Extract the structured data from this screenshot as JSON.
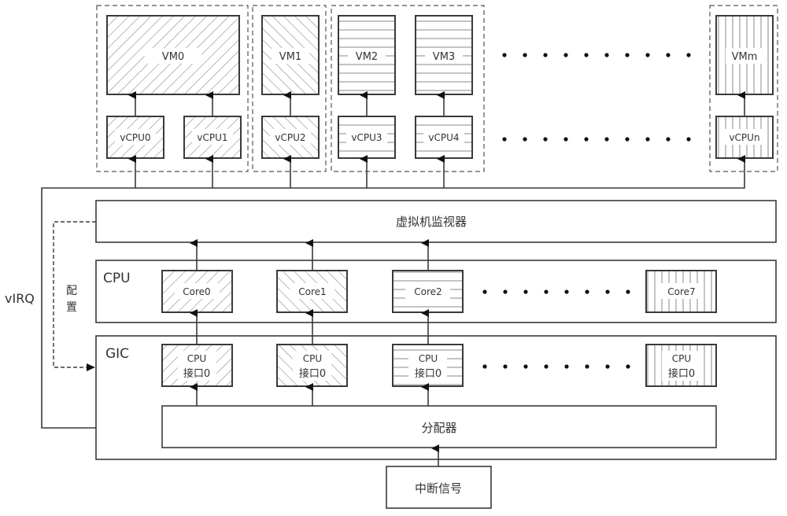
{
  "vm_groups": [
    {
      "vms": [
        "VM0"
      ],
      "vcpus": [
        "vCPU0",
        "vCPU1"
      ]
    },
    {
      "vms": [
        "VM1"
      ],
      "vcpus": [
        "vCPU2"
      ]
    },
    {
      "vms": [
        "VM2",
        "VM3"
      ],
      "vcpus": [
        "vCPU3",
        "vCPU4"
      ]
    },
    {
      "vms": [
        "VMm"
      ],
      "vcpus": [
        "vCPUn"
      ]
    }
  ],
  "hypervisor": {
    "label": "虚拟机监视器"
  },
  "cpu": {
    "title": "CPU",
    "cores": [
      "Core0",
      "Core1",
      "Core2",
      "Core7"
    ]
  },
  "gic": {
    "title": "GIC",
    "interfaces": [
      {
        "line1": "CPU",
        "line2": "接口0"
      },
      {
        "line1": "CPU",
        "line2": "接口0"
      },
      {
        "line1": "CPU",
        "line2": "接口0"
      },
      {
        "line1": "CPU",
        "line2": "接口0"
      }
    ],
    "distributor": "分配器"
  },
  "interrupt_signal": {
    "label": "中断信号"
  },
  "side_labels": {
    "virq": "vIRQ",
    "config_1": "配",
    "config_2": "置"
  },
  "colors": {
    "line": "#3a3a3a",
    "hatch": "#8a8a8a",
    "text": "#333333"
  }
}
